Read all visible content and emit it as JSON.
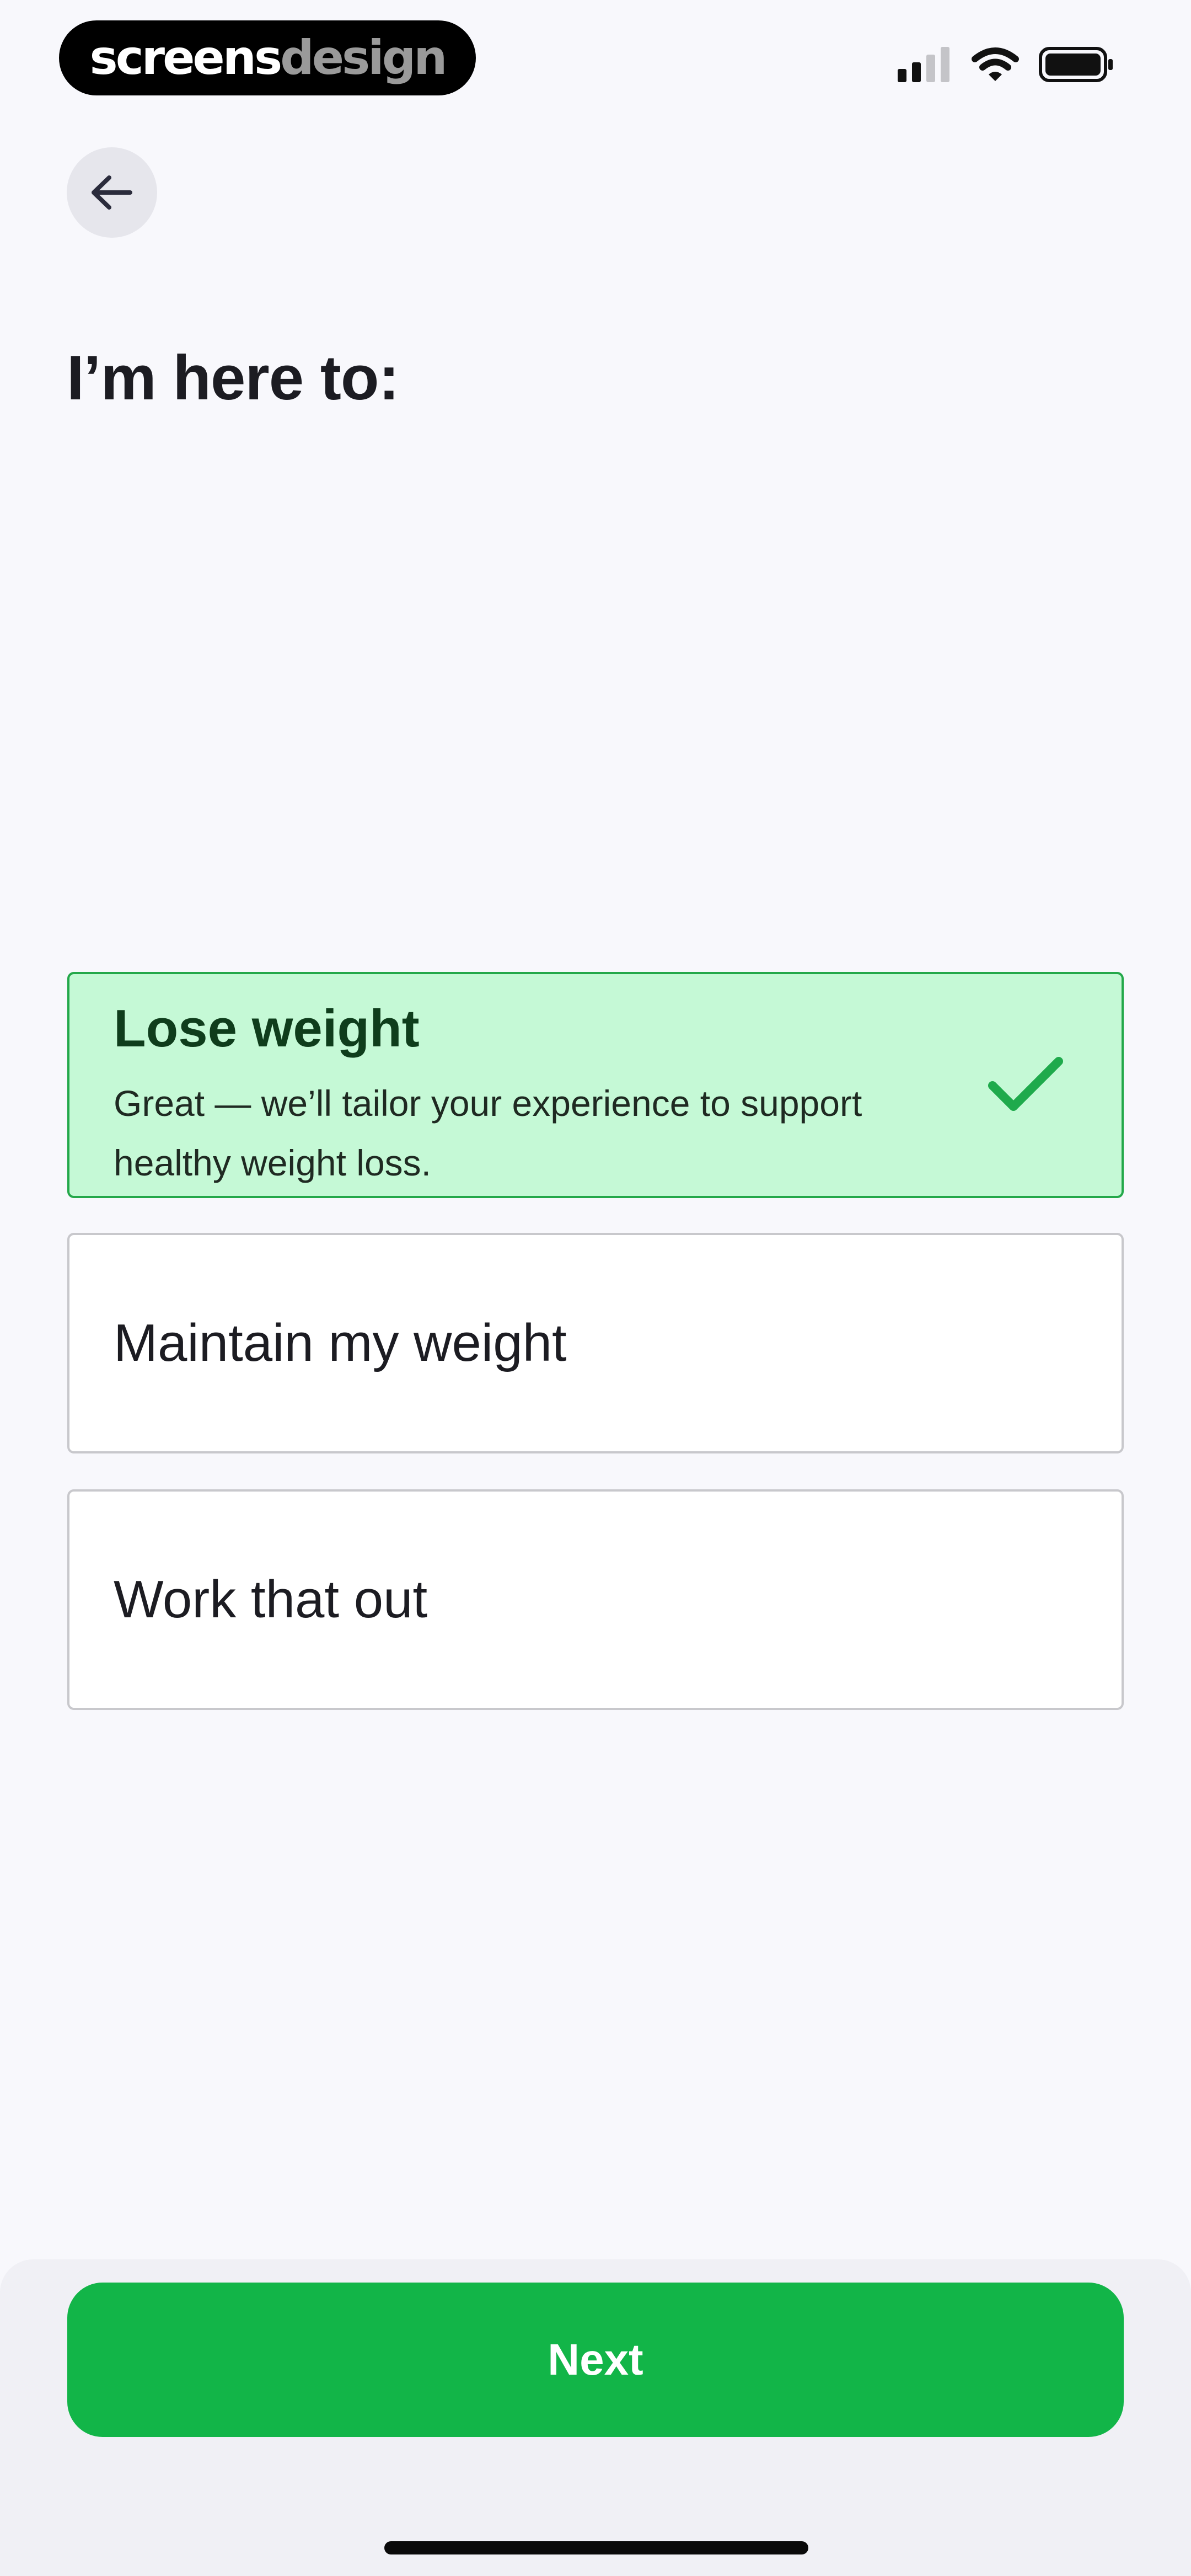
{
  "status_bar": {
    "badge_word_1": "screens",
    "badge_word_2": "design",
    "icons": [
      "signal-icon",
      "wifi-icon",
      "battery-icon"
    ]
  },
  "header": {
    "back_icon": "arrow-left-icon",
    "title": "I’m here to:"
  },
  "options": [
    {
      "label": "Lose weight",
      "description": "Great — we’ll tailor your experience to support healthy weight loss.",
      "selected": true,
      "icon": "checkmark-icon"
    },
    {
      "label": "Maintain my weight",
      "selected": false
    },
    {
      "label": "Work that out",
      "selected": false
    }
  ],
  "footer": {
    "next_label": "Next"
  },
  "colors": {
    "accent": "#12b548",
    "selected_bg": "#c5f9d6",
    "selected_border": "#24a84a",
    "selected_title": "#0f3d1c",
    "page_bg": "#f8f8fc"
  }
}
